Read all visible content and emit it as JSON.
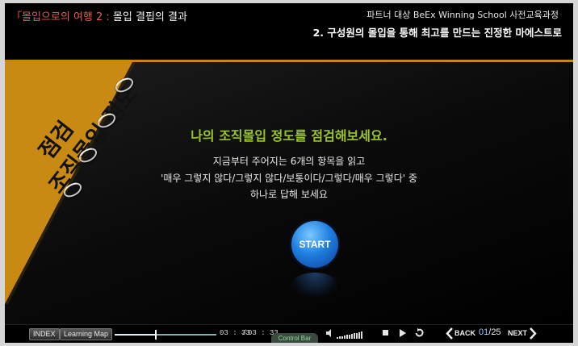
{
  "header": {
    "lesson_bracket": "「",
    "lesson_part1": "몰입으로의 여행 2 :",
    "lesson_part2": " 몰입 결핍의 결과",
    "course_name": "파트너 대상 BeEx Winning School 사전교육과정",
    "chapter_title": "2. 구성원의 몰입을 통해 최고를 만드는 진정한 마에스트로"
  },
  "panel": {
    "title_line1": "조직몰입 정도",
    "title_line2": "점검",
    "accent_color": "#c88a12"
  },
  "content": {
    "title": "나의 조직몰입 정도를 점검해보세요.",
    "line1": "지금부터 주어지는 6개의 항목을 읽고",
    "line2": "'매우 그렇지 않다/그렇지 않다/보통이다/그렇다/매우 그렇다' 중",
    "line3": "하나로 답해 보세요",
    "start_label": "START"
  },
  "controlbar": {
    "index_label": "INDEX",
    "learning_map_label": "Learning Map",
    "time_current": "03 : 33",
    "time_sep": "/",
    "time_total": "03 : 33",
    "control_bar_tab": "Control Bar",
    "back_label": "BACK",
    "next_label": "NEXT",
    "page_current": "01",
    "page_sep": "/",
    "page_total": "25",
    "progress_fraction": 0.4,
    "icons": [
      "volume-icon",
      "stop-icon",
      "play-icon",
      "replay-icon",
      "back-arrow-icon",
      "next-arrow-icon"
    ]
  }
}
